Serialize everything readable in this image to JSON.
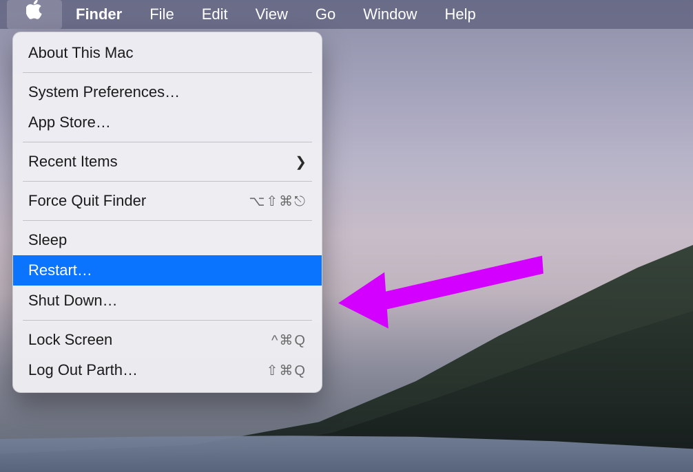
{
  "menubar": {
    "app_label": "Finder",
    "items": [
      "File",
      "Edit",
      "View",
      "Go",
      "Window",
      "Help"
    ]
  },
  "apple_menu": {
    "about": "About This Mac",
    "sysprefs": "System Preferences…",
    "appstore": "App Store…",
    "recent": "Recent Items",
    "forcequit": "Force Quit Finder",
    "forcequit_sc": "⌥⇧⌘⎋",
    "sleep": "Sleep",
    "restart": "Restart…",
    "shutdown": "Shut Down…",
    "lock": "Lock Screen",
    "lock_sc": "^⌘Q",
    "logout": "Log Out Parth…",
    "logout_sc": "⇧⌘Q"
  },
  "annotation": {
    "color": "#d400ff"
  }
}
